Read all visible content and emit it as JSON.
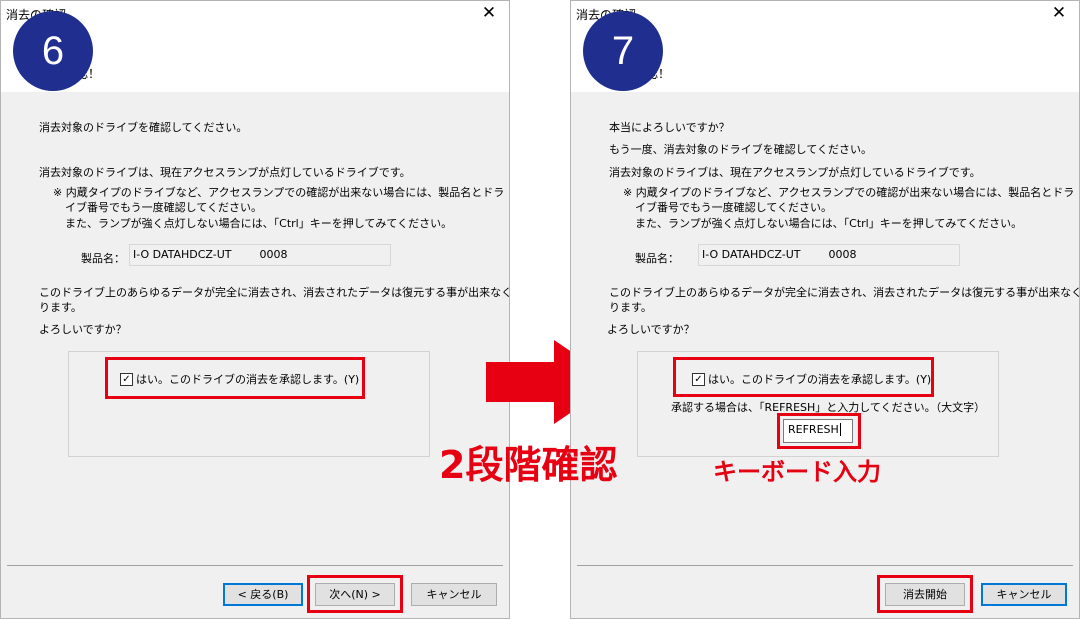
{
  "dialog6": {
    "title": "消去の確認",
    "header": "確認！",
    "step": "6",
    "intro": "消去対象のドライブを確認してください。",
    "desc": "消去対象のドライブは、現在アクセスランプが点灯しているドライブです。",
    "note1": "※ 内蔵タイプのドライブなど、アクセスランプでの確認が出来ない場合には、製品名とドラ",
    "note2": "イブ番号でもう一度確認してください。",
    "note3": "また、ランプが強く点灯しない場合には、「Ctrl」キーを押してみてください。",
    "product_label": "製品名：",
    "product_value": "I-O DATAHDCZ-UT        0008",
    "warning1": "このドライブ上のあらゆるデータが完全に消去され、消去されたデータは復元する事が出来なくな",
    "warning2": "ります。",
    "confirm_q": "よろしいですか？",
    "checkbox_label": "はい。このドライブの消去を承認します。(Y)",
    "checkbox_checked": true,
    "buttons": {
      "back": "< 戻る(B)",
      "next": "次へ(N) >",
      "cancel": "キャンセル"
    }
  },
  "dialog7": {
    "title": "消去の確認",
    "header": "確認！",
    "step": "7",
    "q1": "本当によろしいですか？",
    "q2": "もう一度、消去対象のドライブを確認してください。",
    "desc": "消去対象のドライブは、現在アクセスランプが点灯しているドライブです。",
    "note1": "※ 内蔵タイプのドライブなど、アクセスランプでの確認が出来ない場合には、製品名とドラ",
    "note2": "イブ番号でもう一度確認してください。",
    "note3": "また、ランプが強く点灯しない場合には、「Ctrl」キーを押してみてください。",
    "product_label": "製品名：",
    "product_value": "I-O DATAHDCZ-UT        0008",
    "warning1": "このドライブ上のあらゆるデータが完全に消去され、消去されたデータは復元する事が出来なくな",
    "warning2": "ります。",
    "confirm_q": "よろしいですか？",
    "checkbox_label": "はい。このドライブの消去を承認します。(Y)",
    "checkbox_checked": true,
    "instruction": "承認する場合は、「REFRESH」と入力してください。（大文字）",
    "input_value": "REFRESH",
    "buttons": {
      "start": "消去開始",
      "cancel": "キャンセル"
    }
  },
  "annotations": {
    "two_step": "2段階確認",
    "keyboard": "キーボード入力"
  },
  "colors": {
    "highlight": "#e60012",
    "badge": "#1f2e8f",
    "arrow": "#e60012"
  }
}
